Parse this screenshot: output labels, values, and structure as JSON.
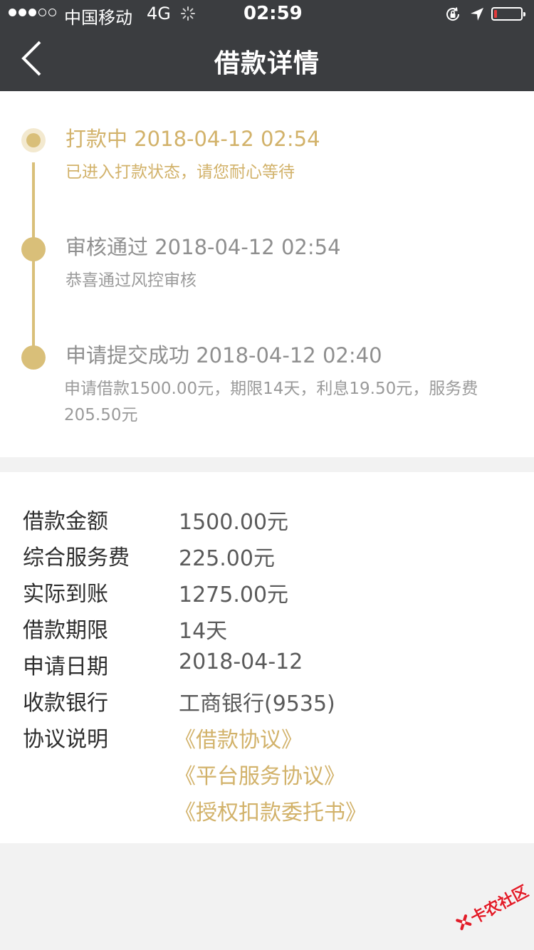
{
  "status_bar": {
    "carrier": "中国移动",
    "network": "4G",
    "time": "02:59",
    "battery_fraction": 0.12
  },
  "nav": {
    "title": "借款详情",
    "back_icon": "chevron-left-icon"
  },
  "timeline": [
    {
      "title": "打款中 2018-04-12 02:54",
      "desc": "已进入打款状态，请您耐心等待",
      "state": "current"
    },
    {
      "title": "审核通过 2018-04-12 02:54",
      "desc": "恭喜通过风控审核",
      "state": "done"
    },
    {
      "title": "申请提交成功 2018-04-12 02:40",
      "desc": "申请借款1500.00元，期限14天，利息19.50元，服务费205.50元",
      "state": "done"
    }
  ],
  "details": [
    {
      "label": "借款金额",
      "value": "1500.00元"
    },
    {
      "label": "综合服务费",
      "value": "225.00元"
    },
    {
      "label": "实际到账",
      "value": "1275.00元"
    },
    {
      "label": "借款期限",
      "value": "14天"
    },
    {
      "label": "申请日期",
      "value": "2018-04-12"
    },
    {
      "label": "收款银行",
      "value": "工商银行(9535)"
    }
  ],
  "agreements": {
    "label": "协议说明",
    "items": [
      "《借款协议》",
      "《平台服务协议》",
      "《授权扣款委托书》"
    ]
  },
  "watermark": {
    "text": "卡农社区"
  },
  "colors": {
    "accent_gold": "#d2b26a",
    "node_gold": "#d9bf79",
    "nav_bg": "#3b3d40",
    "battery_low": "#e33b3b",
    "watermark_red": "#e21c28"
  }
}
